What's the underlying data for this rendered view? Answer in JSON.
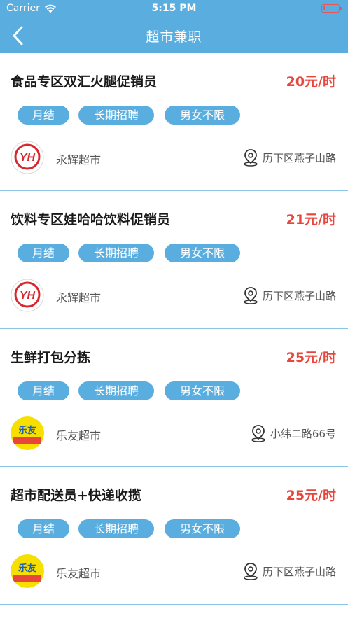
{
  "status_bar": {
    "carrier": "Carrier",
    "time": "5:15 PM"
  },
  "nav": {
    "title": "超市兼职",
    "back_icon": "chevron-left-icon"
  },
  "colors": {
    "header_bg": "#5aaedf",
    "tag_bg": "#5aaedf",
    "salary": "#e8453c",
    "divider": "#8bc4e6"
  },
  "jobs": [
    {
      "title": "食品专区双汇火腿促销员",
      "salary": "20元/时",
      "tags": [
        "月结",
        "长期招聘",
        "男女不限"
      ],
      "store": "永辉超市",
      "logo": "yonghui-logo",
      "logo_text": "YH",
      "address": "历下区燕子山路"
    },
    {
      "title": "饮料专区娃哈哈饮料促销员",
      "salary": "21元/时",
      "tags": [
        "月结",
        "长期招聘",
        "男女不限"
      ],
      "store": "永辉超市",
      "logo": "yonghui-logo",
      "logo_text": "YH",
      "address": "历下区燕子山路"
    },
    {
      "title": "生鲜打包分拣",
      "salary": "25元/时",
      "tags": [
        "月结",
        "长期招聘",
        "男女不限"
      ],
      "store": "乐友超市",
      "logo": "leyou-logo",
      "logo_text": "乐友",
      "address": "小纬二路66号"
    },
    {
      "title": "超市配送员+快递收揽",
      "salary": "25元/时",
      "tags": [
        "月结",
        "长期招聘",
        "男女不限"
      ],
      "store": "乐友超市",
      "logo": "leyou-logo",
      "logo_text": "乐友",
      "address": "历下区燕子山路"
    }
  ]
}
